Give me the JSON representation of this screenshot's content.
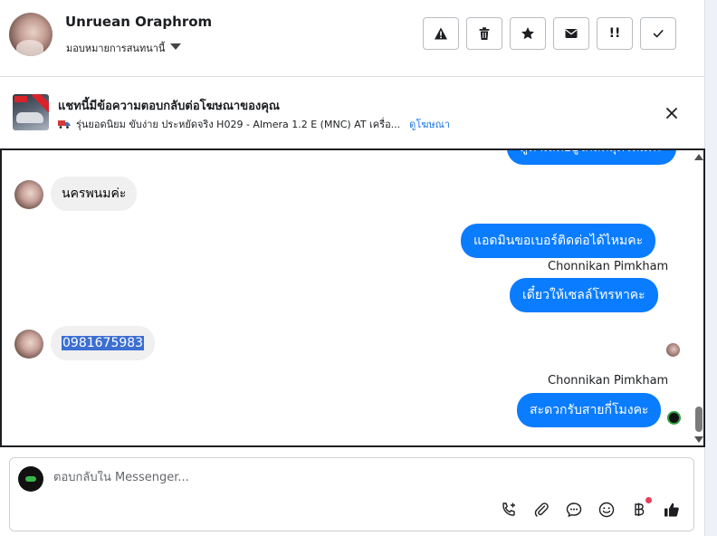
{
  "header": {
    "name": "Unruean Oraphrom",
    "assign_label": "มอบหมายการสนทนานี้",
    "actions": [
      {
        "icon": "alert-triangle-icon",
        "label": "spam"
      },
      {
        "icon": "trash-icon",
        "label": "delete"
      },
      {
        "icon": "star-icon",
        "label": "star"
      },
      {
        "icon": "envelope-icon",
        "label": "mark unread"
      },
      {
        "icon": "follow-up-icon",
        "label": "!!"
      },
      {
        "icon": "check-icon",
        "label": "done"
      }
    ]
  },
  "ad": {
    "title": "แชทนี้มีข้อความตอบกลับต่อโฆษณาของคุณ",
    "description": "รุ่นยอดนิยม ขับง่าย ประหยัดจริง H029 - Almera 1.2 E (MNC) AT เครื่อ...",
    "link": "ดูโฆษณา"
  },
  "messages": [
    {
      "from": "page",
      "text": "ดูทำเลที่อยู่ใกล้ที่สุดไหมคะ",
      "cut": true
    },
    {
      "from": "user",
      "text": "นครพนมค่ะ"
    },
    {
      "from": "page",
      "text": "แอดมินขอเบอร์ติดต่อได้ไหมคะ"
    },
    {
      "from": "page",
      "sender": "Chonnikan Pimkham",
      "text": "เดี๋ยวให้เซลล์โทรหาคะ"
    },
    {
      "from": "user",
      "text": "0981675983",
      "selected": true
    },
    {
      "from": "page",
      "sender": "Chonnikan Pimkham",
      "text": "สะดวกรับสายกี่โมงคะ"
    }
  ],
  "composer": {
    "placeholder": "ตอบกลับใน Messenger...",
    "tools": [
      "phone-plus-icon",
      "paperclip-icon",
      "chat-bubble-icon",
      "emoji-icon",
      "baht-icon",
      "thumbs-up-icon"
    ]
  },
  "colors": {
    "outgoing_bubble": "#0a7cff",
    "incoming_bubble": "#f0f0f0",
    "link": "#1b74e4",
    "notification": "#e4405f"
  }
}
